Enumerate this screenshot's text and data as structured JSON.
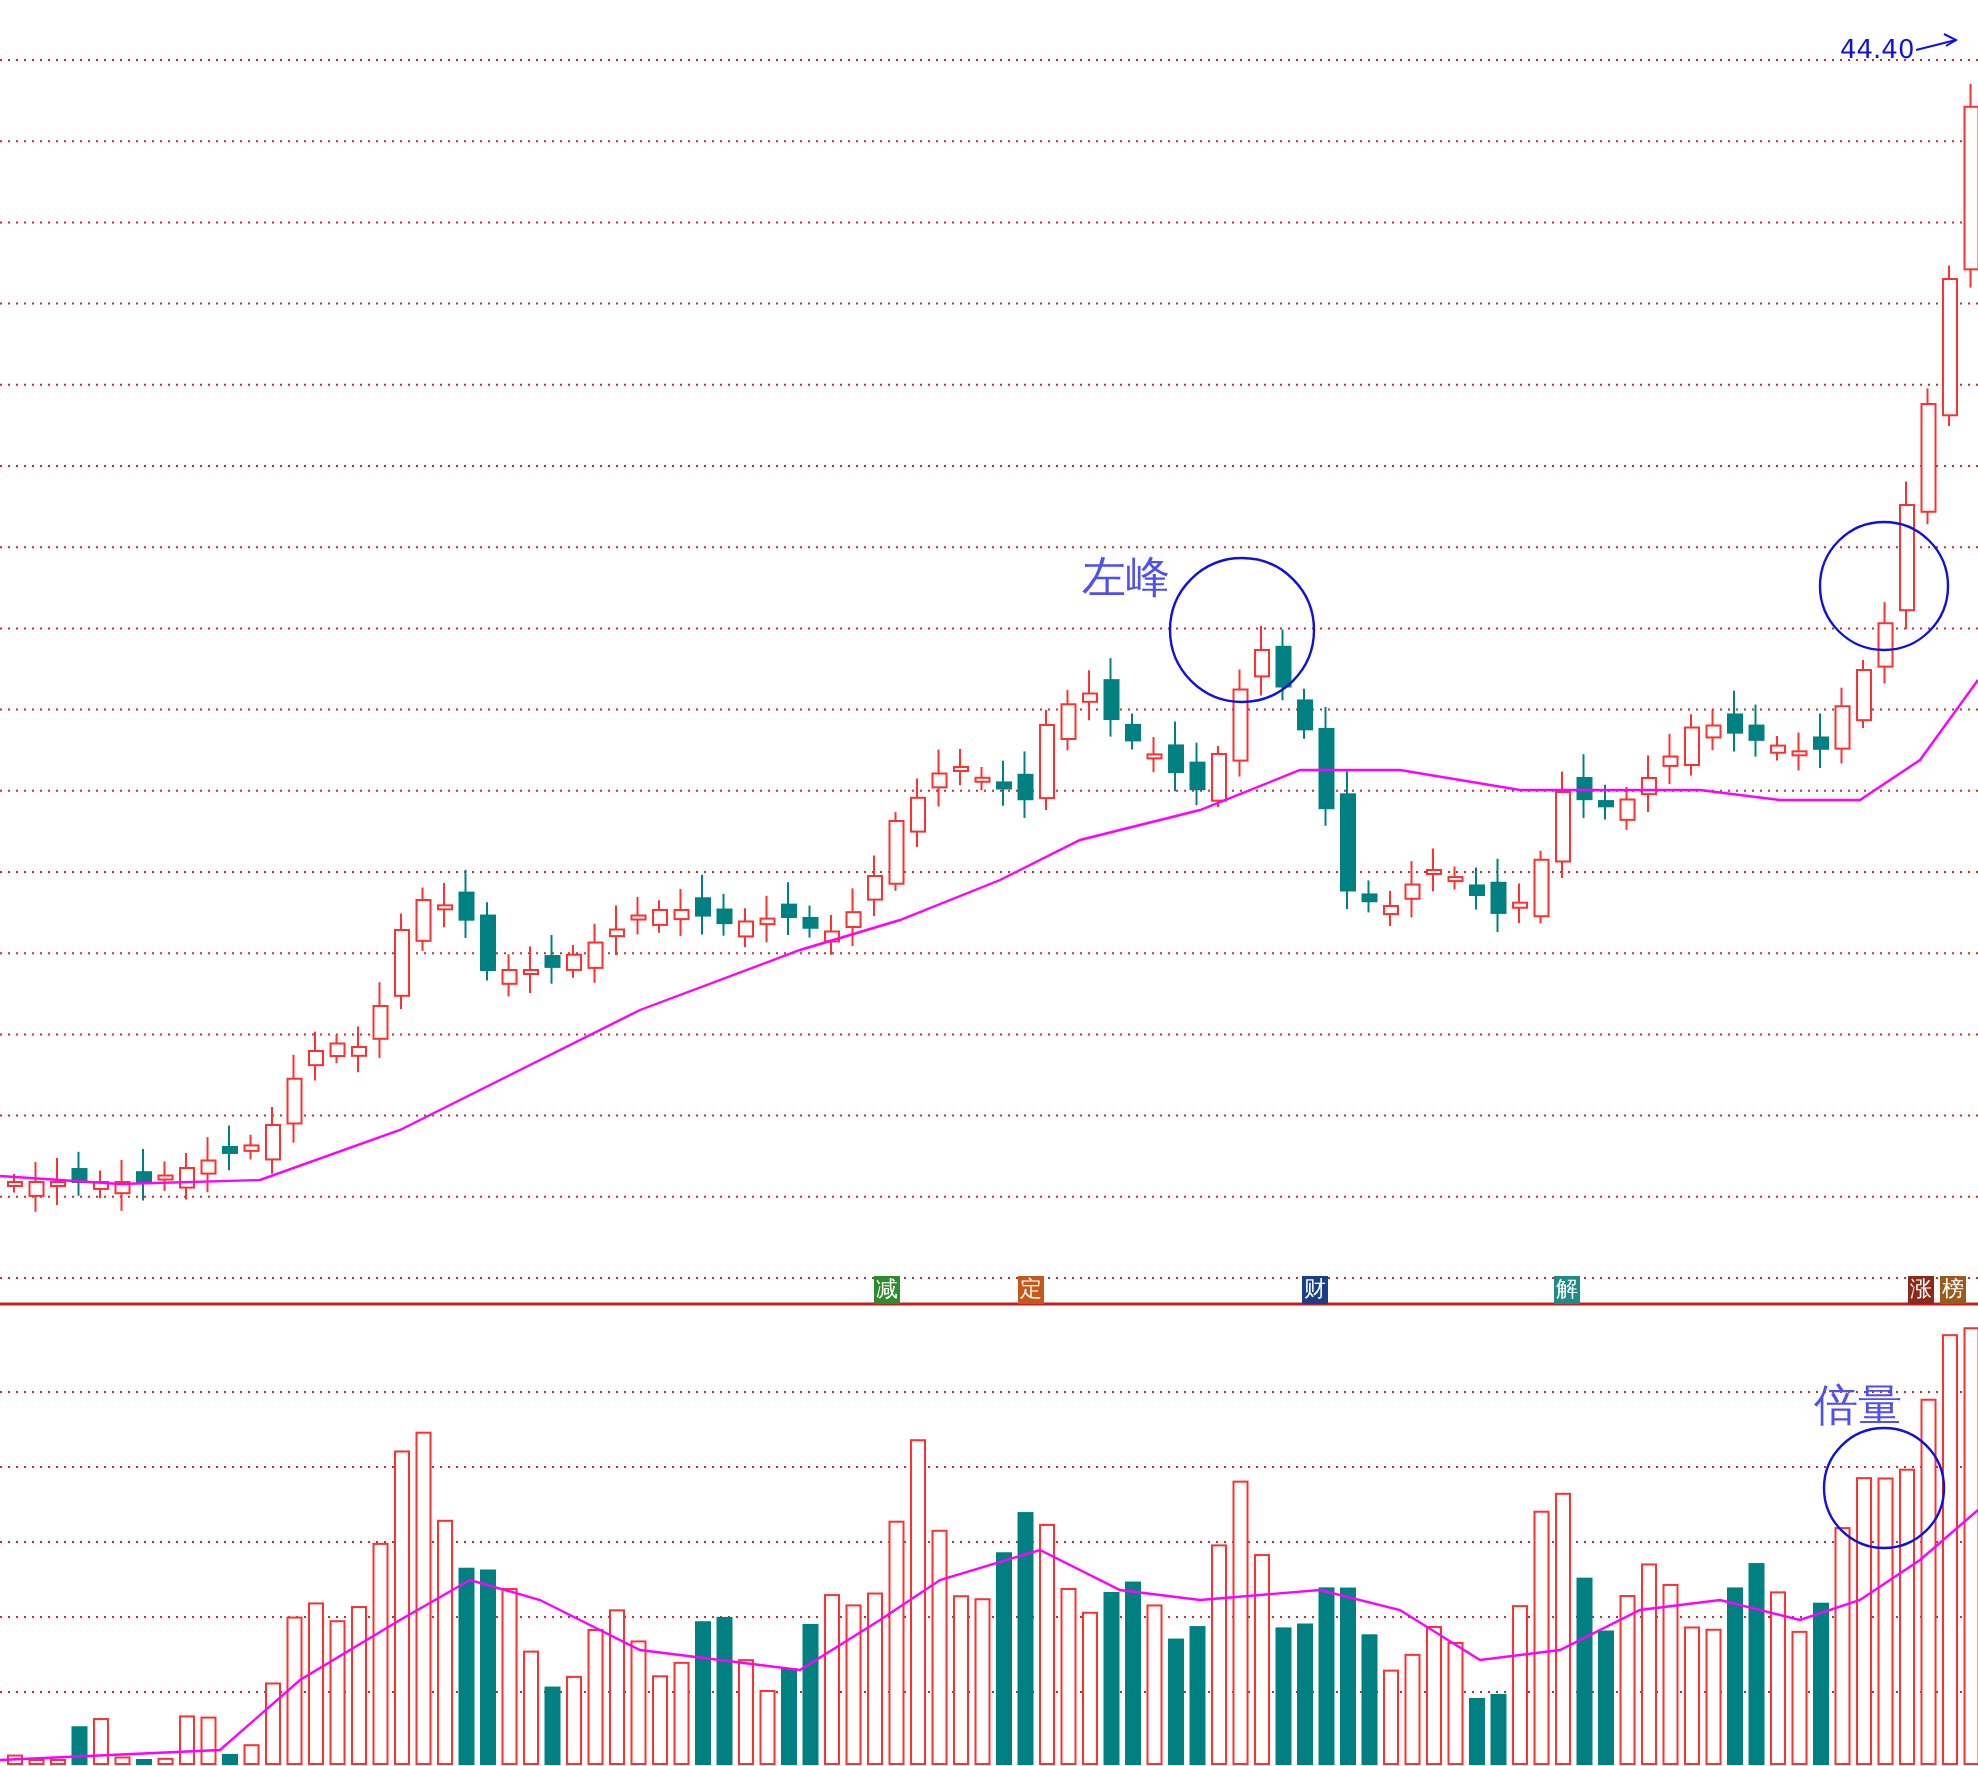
{
  "price_label": "44.40",
  "annotations": [
    {
      "text": "左峰"
    },
    {
      "text": "倍量"
    }
  ],
  "markers": [
    {
      "text": "减",
      "color": "#2e8b2e"
    },
    {
      "text": "定",
      "color": "#c8581a"
    },
    {
      "text": "财",
      "color": "#1a3f8a"
    },
    {
      "text": "解",
      "color": "#1f8a8a"
    },
    {
      "text": "涨",
      "color": "#8b2a1a"
    },
    {
      "text": "榜",
      "color": "#9a5a1a"
    }
  ]
}
